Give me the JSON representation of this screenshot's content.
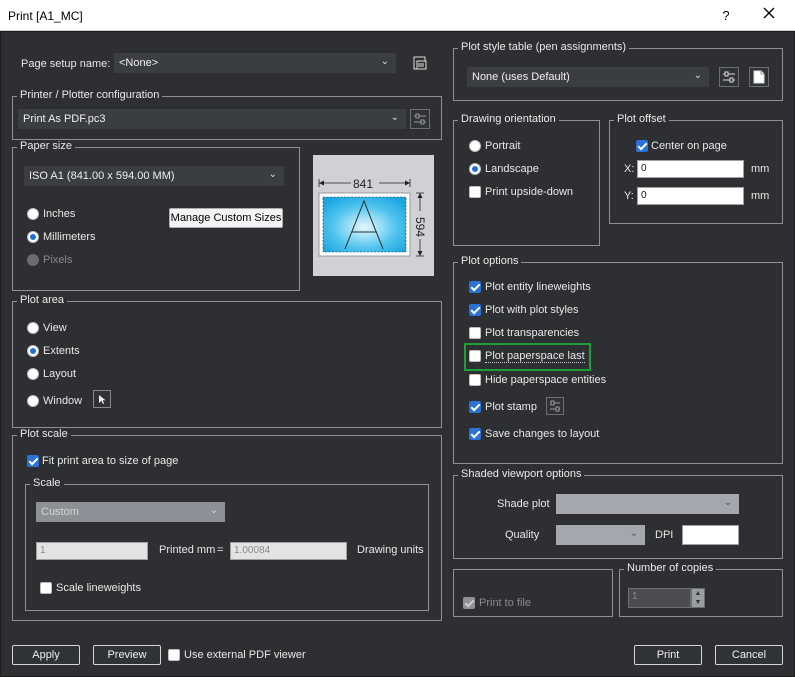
{
  "window": {
    "title": "Print [A1_MC]",
    "help_label": "?",
    "close_label": "✕"
  },
  "page_setup": {
    "label": "Page setup name:",
    "value": "<None>"
  },
  "printer": {
    "legend": "Printer / Plotter configuration",
    "value": "Print As PDF.pc3"
  },
  "paper": {
    "legend": "Paper size",
    "value": "ISO A1 (841.00 x 594.00 MM)",
    "manage_label": "Manage Custom Sizes",
    "units": [
      {
        "label": "Inches",
        "selected": false,
        "enabled": true
      },
      {
        "label": "Millimeters",
        "selected": true,
        "enabled": true
      },
      {
        "label": "Pixels",
        "selected": false,
        "enabled": false
      }
    ],
    "preview": {
      "width": "841",
      "height": "594",
      "letter": "A"
    }
  },
  "plot_area": {
    "legend": "Plot area",
    "options": [
      {
        "label": "View",
        "selected": false
      },
      {
        "label": "Extents",
        "selected": true
      },
      {
        "label": "Layout",
        "selected": false
      },
      {
        "label": "Window",
        "selected": false
      }
    ]
  },
  "plot_scale": {
    "legend": "Plot scale",
    "fit_label": "Fit print area to size of page",
    "fit_checked": true,
    "scale_legend": "Scale",
    "scale_value": "Custom",
    "numerator": "1",
    "printed_label": "Printed mm",
    "equals": "=",
    "denominator": "1.00084",
    "units_label": "Drawing units",
    "lineweights_label": "Scale lineweights",
    "lineweights_checked": false
  },
  "plot_style": {
    "legend": "Plot style table (pen assignments)",
    "value": "None (uses Default)"
  },
  "orientation": {
    "legend": "Drawing orientation",
    "portrait": "Portrait",
    "landscape": "Landscape",
    "upside_down": "Print upside-down",
    "selected": "landscape",
    "upside_checked": false
  },
  "offset": {
    "legend": "Plot offset",
    "center_label": "Center on page",
    "center_checked": true,
    "x_label": "X:",
    "x_value": "0",
    "y_label": "Y:",
    "y_value": "0",
    "unit": "mm"
  },
  "plot_options": {
    "legend": "Plot options",
    "items": [
      {
        "label": "Plot entity lineweights",
        "checked": true
      },
      {
        "label": "Plot with plot styles",
        "checked": true
      },
      {
        "label": "Plot transparencies",
        "checked": false
      },
      {
        "label": "Plot paperspace last",
        "checked": false
      },
      {
        "label": "Hide paperspace entities",
        "checked": false
      },
      {
        "label": "Plot stamp",
        "checked": true
      },
      {
        "label": "Save changes to layout",
        "checked": true
      }
    ]
  },
  "shaded": {
    "legend": "Shaded viewport options",
    "shade_label": "Shade plot",
    "quality_label": "Quality",
    "dpi_label": "DPI"
  },
  "print_to_file": {
    "label": "Print to file",
    "checked": true,
    "enabled": false
  },
  "copies": {
    "legend": "Number of copies",
    "value": "1"
  },
  "footer": {
    "apply": "Apply",
    "preview": "Preview",
    "external_pdf": "Use external PDF viewer",
    "external_checked": false,
    "print": "Print",
    "cancel": "Cancel"
  },
  "colors": {
    "accent": "#2a72d4",
    "highlight": "#1e9e3a",
    "preview_fill": "#4fc3ee"
  },
  "icons": [
    "page-setup-icon",
    "printer-properties-icon",
    "plot-style-edit-icon",
    "new-plot-style-icon",
    "window-pick-icon",
    "plot-stamp-settings-icon",
    "chevron-down-icon",
    "spinner-icon",
    "close-icon",
    "help-icon"
  ]
}
